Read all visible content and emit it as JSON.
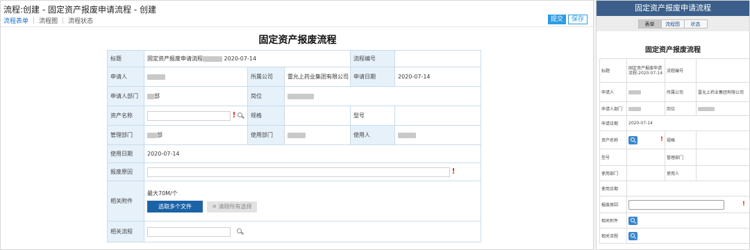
{
  "desktop": {
    "window_title": "流程:创建 - 固定资产报废申请流程 - 创建",
    "tabs": [
      "流程表单",
      "流程图",
      "流程状态"
    ],
    "submit_label": "提交",
    "save_label": "保存",
    "form_title": "固定资产报废流程",
    "fields": {
      "title_label": "标题",
      "title_value_prefix": "固定资产报废申请流程",
      "title_value_date": "2020-07-14",
      "flow_no_label": "流程编号",
      "applicant_label": "申请人",
      "company_label": "所属公司",
      "company_value": "雷允上药业集团有限公司",
      "apply_date_label": "申请日期",
      "apply_date_value": "2020-07-14",
      "applicant_dept_label": "申请人部门",
      "applicant_dept_suffix": "部",
      "position_label": "岗位",
      "asset_name_label": "资产名称",
      "spec_label": "规格",
      "model_label": "型号",
      "mgmt_dept_label": "管理部门",
      "mgmt_dept_suffix": "部",
      "use_dept_label": "使用部门",
      "user_label": "使用人",
      "use_date_label": "使用日期",
      "use_date_value": "2020-07-14",
      "scrap_reason_label": "报废原因",
      "attachment_label": "相关附件",
      "attachment_limit": "最大70M/个",
      "upload_label": "选取多个文件",
      "clear_label": "清除所有选择",
      "related_flow_label": "相关流程",
      "required_mark": "!"
    }
  },
  "mobile": {
    "header_title": "固定资产报废申请流程",
    "tabs": [
      "表单",
      "流程图",
      "状态"
    ],
    "form_title": "固定资产报废流程",
    "fields": {
      "title_label": "标题",
      "title_value": "固定资产报废申请流程-2020-07-14",
      "flow_no_label": "流程编号",
      "applicant_label": "申请人",
      "company_label": "所属公司",
      "company_value": "雷允上药业集团有限公司",
      "applicant_dept_label": "申请人部门",
      "position_label": "岗位",
      "apply_date_label": "申请日期",
      "apply_date_value": "2020-07-14",
      "asset_name_label": "资产名称",
      "spec_label": "规格",
      "model_label": "型号",
      "mgmt_dept_label": "管理部门",
      "use_dept_label": "使用部门",
      "user_label": "使用人",
      "use_date_label": "使用日期",
      "scrap_reason_label": "报废原因",
      "attachment_label": "相关附件",
      "related_flow_label": "相关流程",
      "required_mark": "!"
    }
  },
  "colors": {
    "accent": "#2d9be3",
    "label_bg": "#e6f1fa",
    "mobile_header": "#3b5f8a",
    "required": "#e53030",
    "upload_button": "#1b63a6"
  }
}
